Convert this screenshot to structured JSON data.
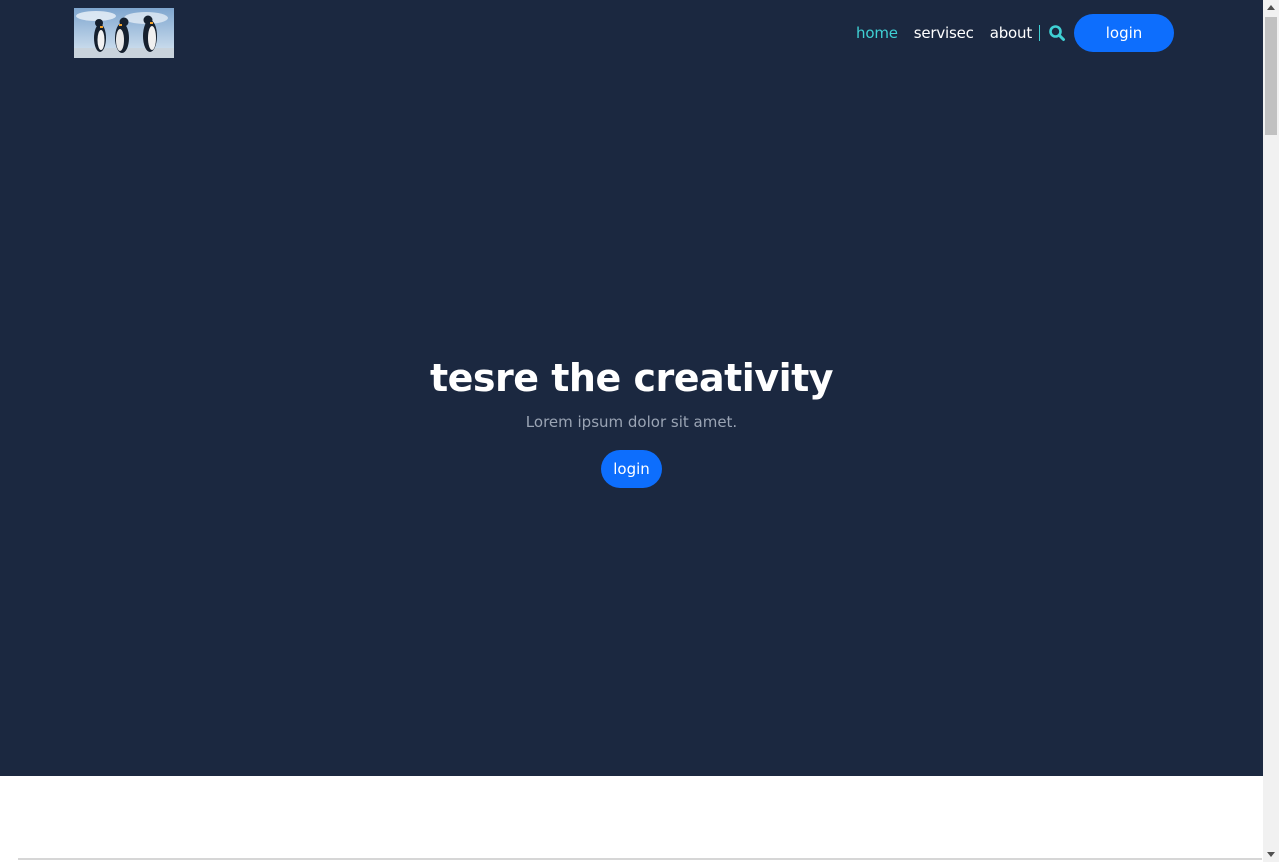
{
  "header": {
    "logo_alt": "penguins logo",
    "nav": [
      {
        "label": "home",
        "active": true
      },
      {
        "label": "servisec",
        "active": false
      },
      {
        "label": "about",
        "active": false
      }
    ],
    "search_icon": "search-icon",
    "login_label": "login"
  },
  "hero": {
    "title": "tesre the creativity",
    "subtitle": "Lorem ipsum dolor sit amet.",
    "button_label": "login"
  },
  "colors": {
    "background": "#1b2840",
    "accent": "#3fd0d4",
    "button": "#0d6efd"
  }
}
